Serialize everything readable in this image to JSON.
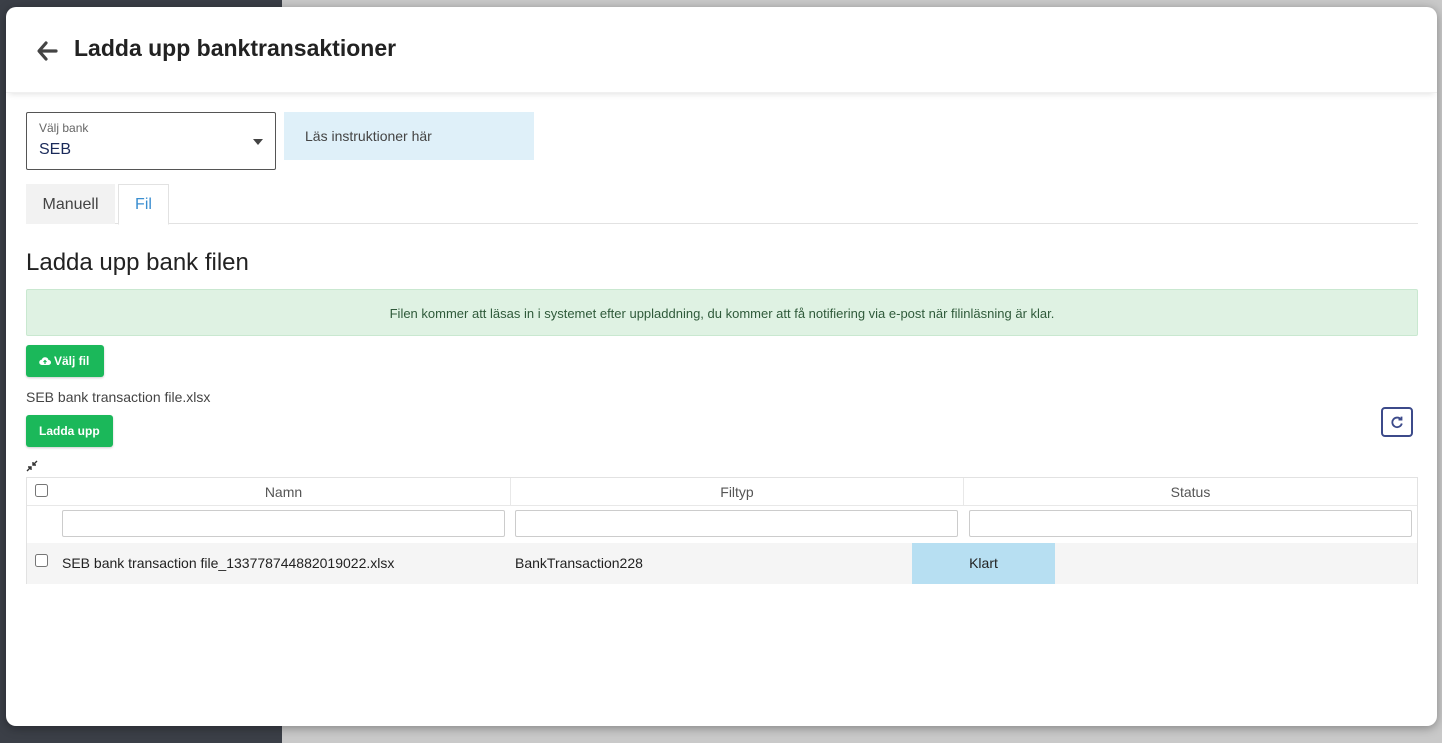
{
  "header": {
    "title": "Ladda upp banktransaktioner"
  },
  "bank_select": {
    "label": "Välj bank",
    "value": "SEB"
  },
  "instructions_link": "Läs instruktioner här",
  "tabs": [
    {
      "label": "Manuell",
      "active": false
    },
    {
      "label": "Fil",
      "active": true
    }
  ],
  "section": {
    "title": "Ladda upp bank filen",
    "info": "Filen kommer att läsas in i systemet efter uppladdning, du kommer att få notifiering via e-post när filinläsning är klar."
  },
  "choose_file_label": "Välj fil",
  "selected_file": "SEB bank transaction file.xlsx",
  "upload_label": "Ladda upp",
  "grid": {
    "columns": [
      "Namn",
      "Filtyp",
      "Status"
    ],
    "rows": [
      {
        "name": "SEB bank transaction file_133778744882019022.xlsx",
        "type": "BankTransaction228",
        "status": "Klart"
      }
    ]
  },
  "colors": {
    "accent_green": "#1bb85a",
    "tab_active": "#3a8ed0",
    "status_done_bg": "#b7dff2",
    "info_bg": "#dff2e3"
  }
}
